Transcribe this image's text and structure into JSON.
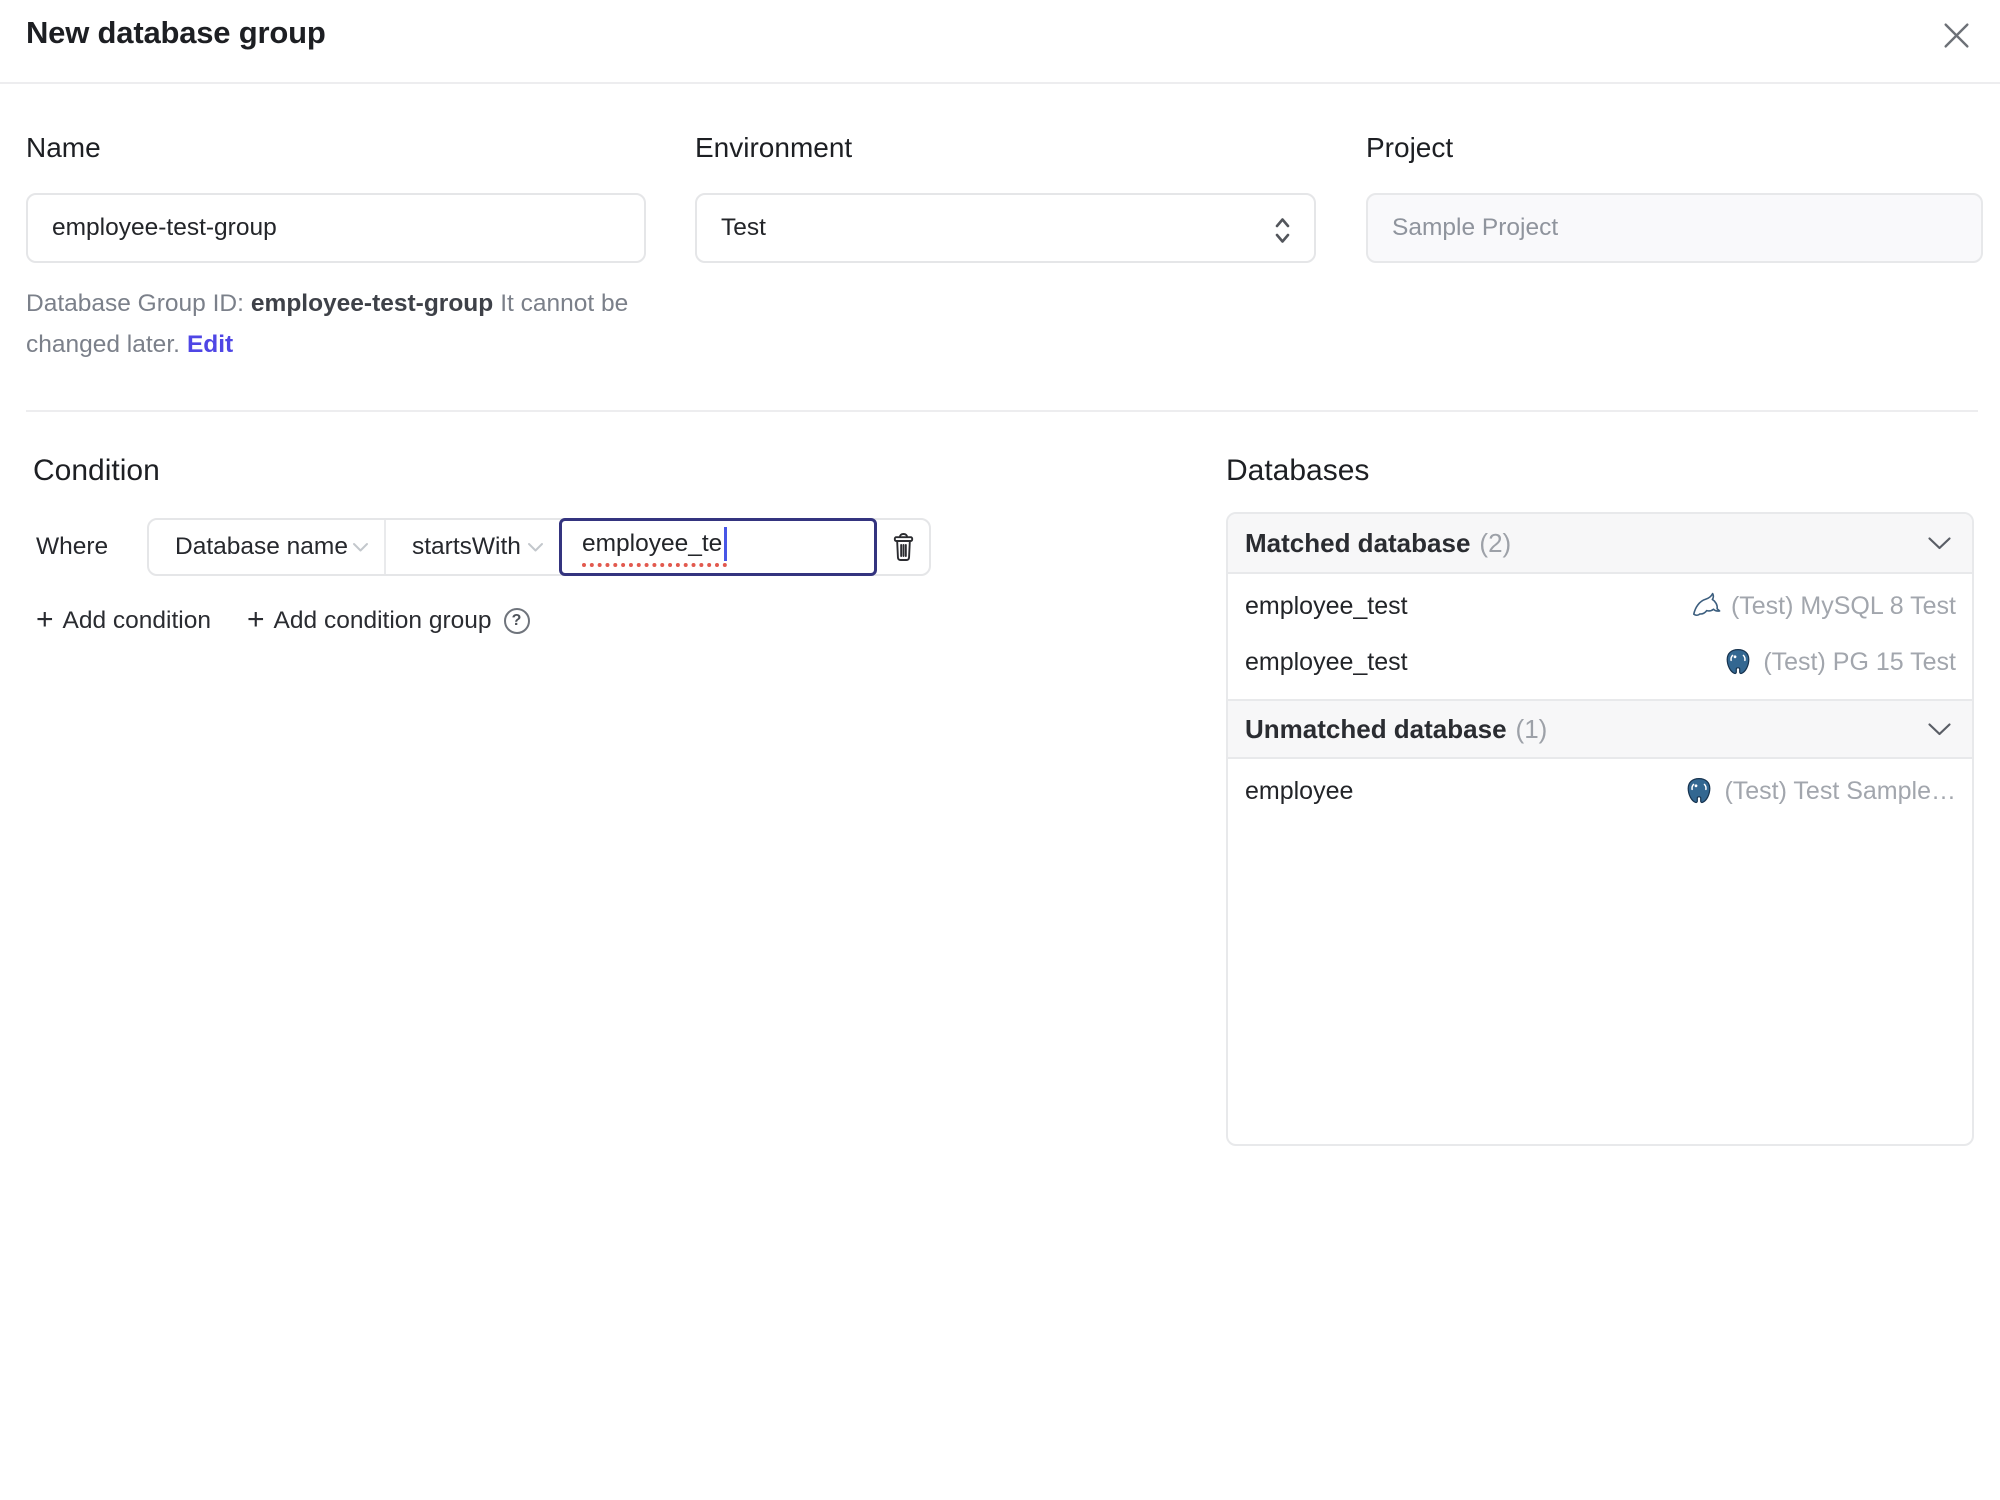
{
  "dialog": {
    "title": "New database group"
  },
  "icons": {
    "plus": "+",
    "help": "?"
  },
  "form": {
    "name_label": "Name",
    "name_value": "employee-test-group",
    "environment_label": "Environment",
    "environment_value": "Test",
    "project_label": "Project",
    "project_value": "Sample Project",
    "group_id_prefix": "Database Group ID:",
    "group_id_value": "employee-test-group",
    "group_id_note": "It cannot be changed later.",
    "edit_link": "Edit"
  },
  "condition": {
    "heading": "Condition",
    "where_label": "Where",
    "field": "Database name",
    "operator": "startsWith",
    "value": "employee_te",
    "add_condition": "Add condition",
    "add_condition_group": "Add condition group"
  },
  "databases": {
    "heading": "Databases",
    "matched": {
      "title": "Matched database",
      "count": "(2)",
      "rows": [
        {
          "name": "employee_test",
          "engine": "mysql",
          "instance": "(Test) MySQL 8 Test"
        },
        {
          "name": "employee_test",
          "engine": "postgres",
          "instance": "(Test) PG 15 Test"
        }
      ]
    },
    "unmatched": {
      "title": "Unmatched database",
      "count": "(1)",
      "rows": [
        {
          "name": "employee",
          "engine": "postgres",
          "instance": "(Test) Test Sample…"
        }
      ]
    }
  },
  "colors": {
    "accent": "#4f46e5",
    "focus_border": "#34347f",
    "spellcheck_underline": "#e2594e",
    "mysql_icon": "#3c5e7e",
    "postgres_icon": "#336791",
    "section_header_bg": "#f7f7f8",
    "border": "#e8e9eb"
  }
}
